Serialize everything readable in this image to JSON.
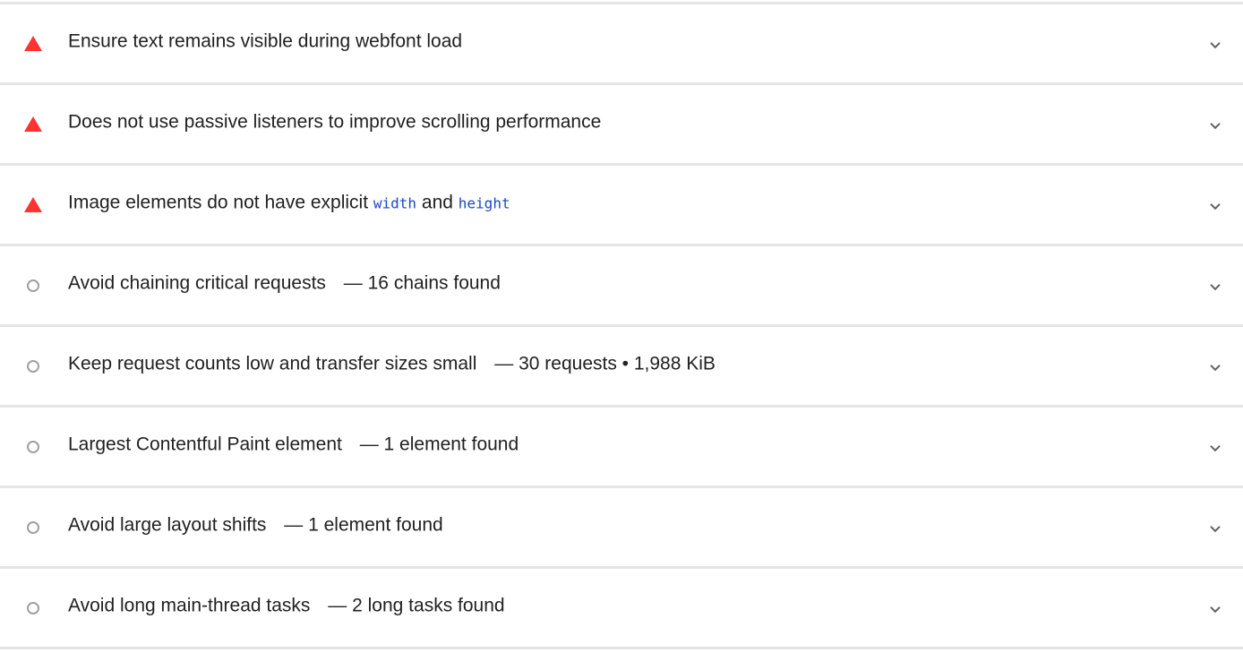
{
  "audits": [
    {
      "status": "fail",
      "title": "Ensure text remains visible during webfont load"
    },
    {
      "status": "fail",
      "title": "Does not use passive listeners to improve scrolling performance"
    },
    {
      "status": "fail",
      "title_prefix": "Image elements do not have explicit",
      "code_1": "width",
      "title_mid": "and",
      "code_2": "height"
    },
    {
      "status": "informative",
      "title": "Avoid chaining critical requests",
      "separator": "—",
      "display_value": "16 chains found"
    },
    {
      "status": "informative",
      "title": "Keep request counts low and transfer sizes small",
      "separator": "—",
      "display_value": "30 requests • 1,988 KiB"
    },
    {
      "status": "informative",
      "title": "Largest Contentful Paint element",
      "separator": "—",
      "display_value": "1 element found"
    },
    {
      "status": "informative",
      "title": "Avoid large layout shifts",
      "separator": "—",
      "display_value": "1 element found"
    },
    {
      "status": "informative",
      "title": "Avoid long main-thread tasks",
      "separator": "—",
      "display_value": "2 long tasks found"
    }
  ],
  "colors": {
    "fail": "#ff3333",
    "informative": "#a0a0a0",
    "code": "#1a48c4",
    "divider": "#e5e5e5"
  },
  "icons": {
    "fail": "fail-triangle-icon",
    "informative": "informative-circle-icon",
    "expand": "chevron-down-icon"
  }
}
